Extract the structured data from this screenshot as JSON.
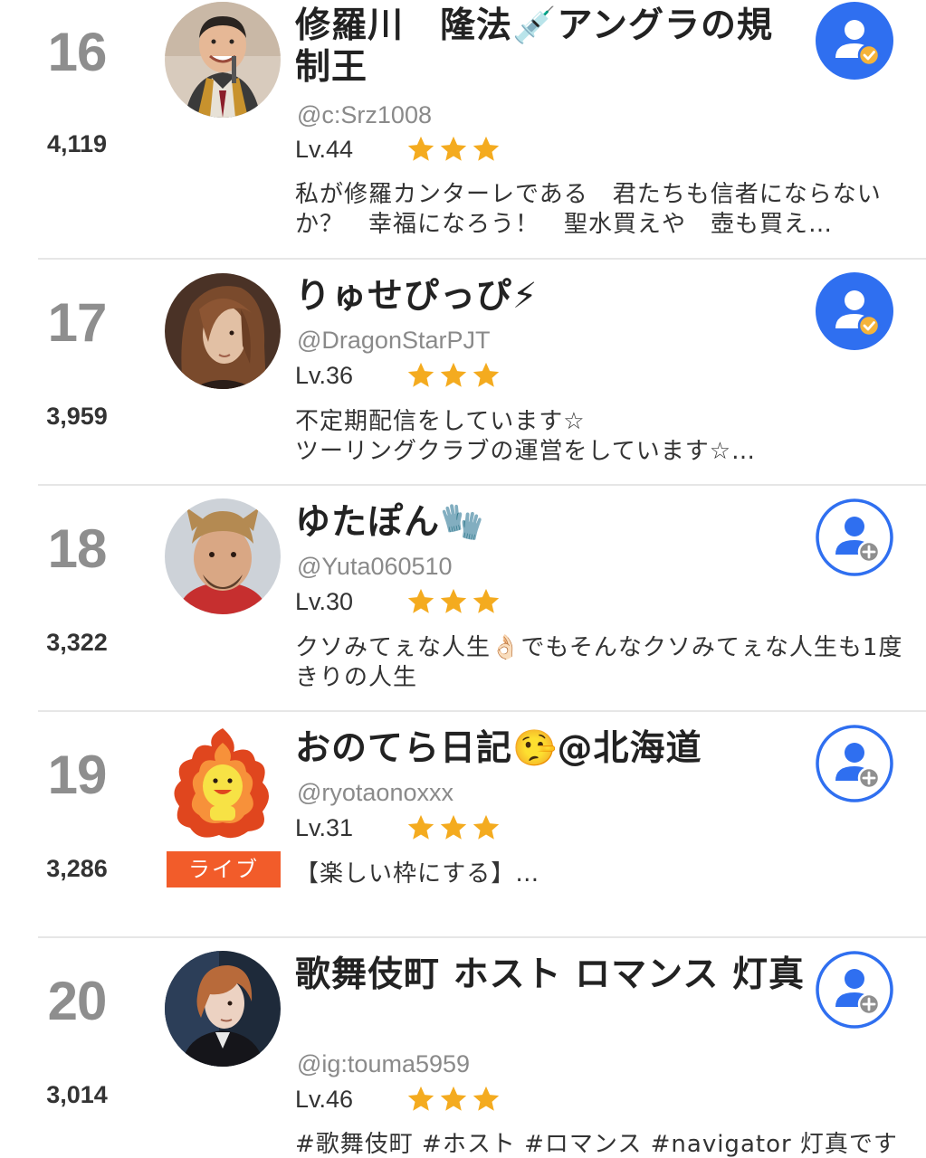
{
  "rows": [
    {
      "rank": "16",
      "score": "4,119",
      "name": "修羅川　隆法💉アングラの規制王",
      "handle": "@c:Srz1008",
      "level": "Lv.44",
      "stars": 3,
      "bio": "私が修羅カンターレである　君たちも信者にならないか？　幸福になろう！　聖水買えや　壺も買え…",
      "following": true,
      "live": false
    },
    {
      "rank": "17",
      "score": "3,959",
      "name": "りゅせぴっぴ⚡",
      "handle": "@DragonStarPJT",
      "level": "Lv.36",
      "stars": 3,
      "bio": "不定期配信をしています☆\nツーリングクラブの運営をしています☆…",
      "following": true,
      "live": false
    },
    {
      "rank": "18",
      "score": "3,322",
      "name": "ゆたぽん🧤",
      "handle": "@Yuta060510",
      "level": "Lv.30",
      "stars": 3,
      "bio": "クソみてぇな人生👌🏻でもそんなクソみてぇな人生も1度きりの人生",
      "following": false,
      "live": false
    },
    {
      "rank": "19",
      "score": "3,286",
      "name": "おのてら日記🤥@北海道",
      "handle": "@ryotaonoxxx",
      "level": "Lv.31",
      "stars": 3,
      "bio": "【楽しい枠にする】…",
      "following": false,
      "live": true,
      "live_label": "ライブ"
    },
    {
      "rank": "20",
      "score": "3,014",
      "name": "歌舞伎町 ホスト ロマンス 灯真",
      "handle": "@ig:touma5959",
      "level": "Lv.46",
      "stars": 3,
      "bio": "#歌舞伎町 #ホスト #ロマンス #navigator 灯真です",
      "following": false,
      "live": false
    }
  ],
  "icons": {
    "following": "user-check-icon",
    "not_following": "user-add-icon",
    "star": "star-icon"
  },
  "colors": {
    "follow_blue": "#2f6ff0",
    "check_gold": "#f4b33a",
    "star_gold": "#f4ab1f",
    "live_orange": "#f25c2a",
    "rank_gray": "#8e8e8e",
    "handle_gray": "#8a8a8a"
  }
}
